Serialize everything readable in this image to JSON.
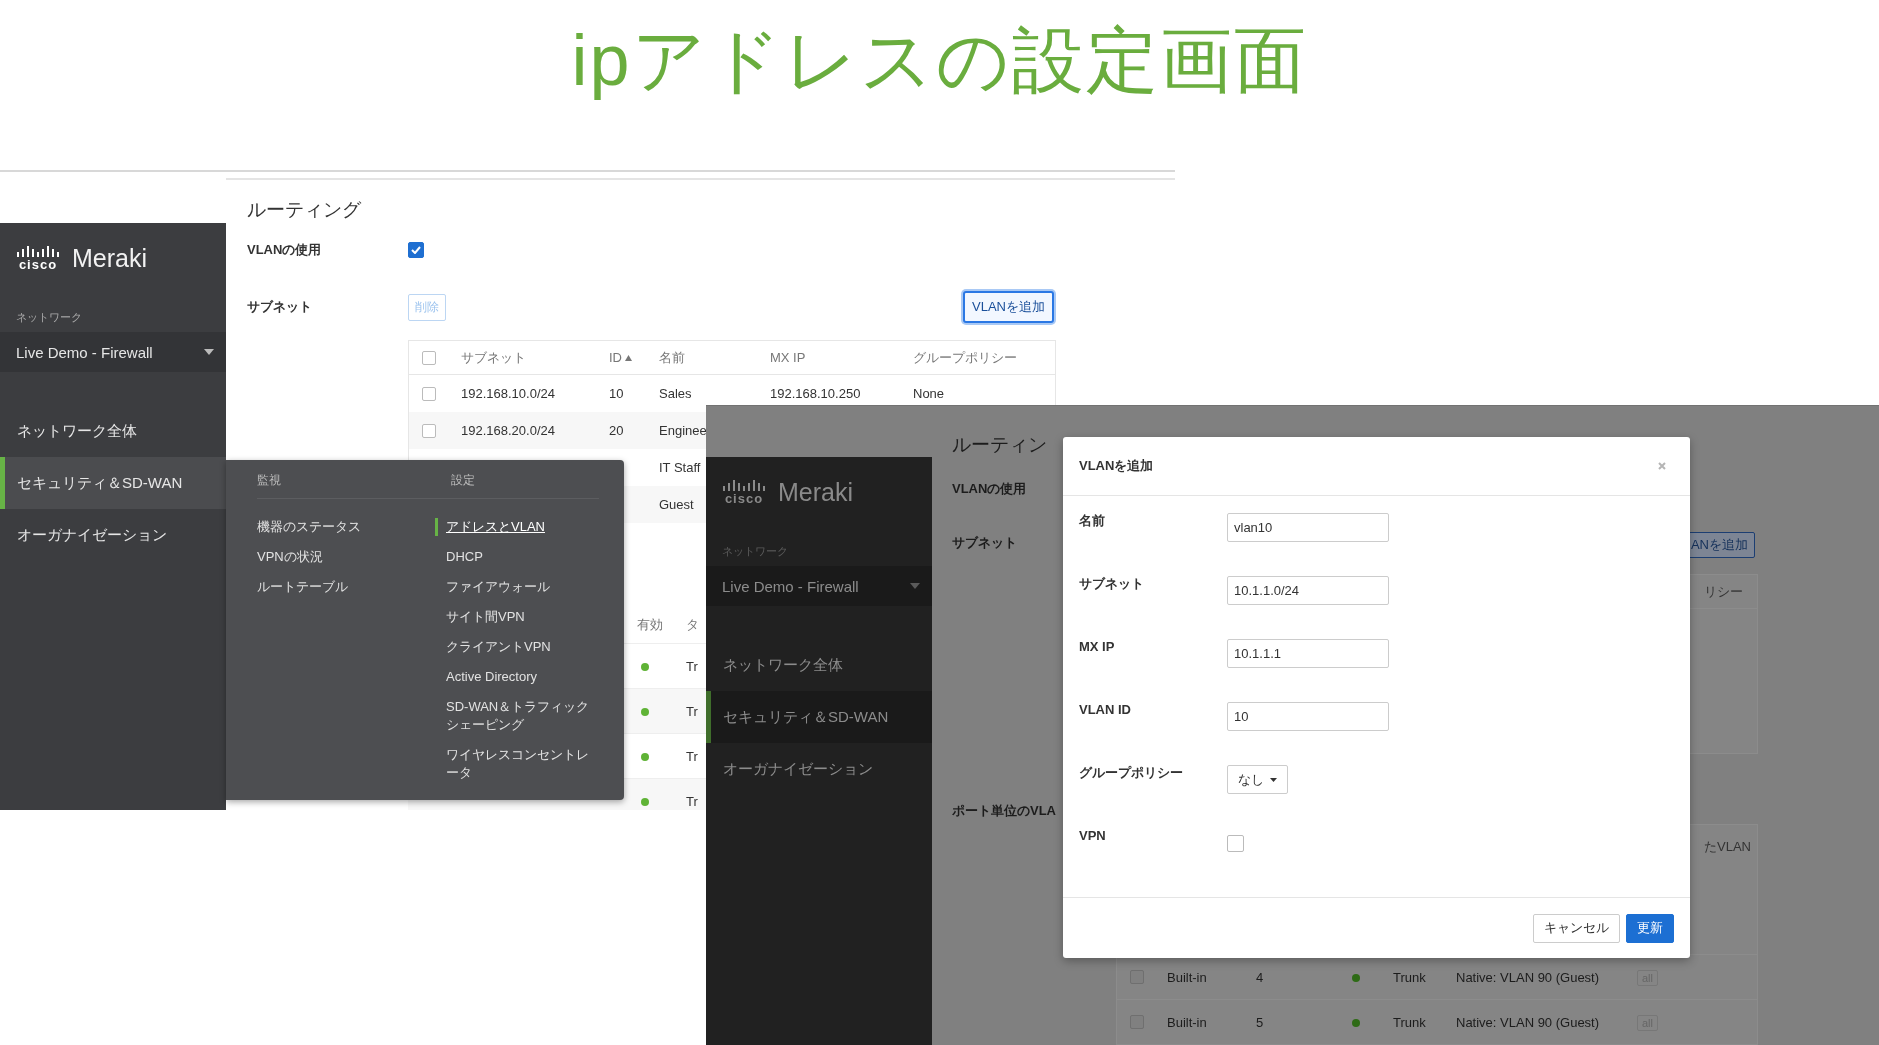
{
  "slide_title": "ipアドレスの設定画面",
  "screen_1": {
    "logo_text": "cisco",
    "brand": "Meraki",
    "sidebar": {
      "section_label": "ネットワーク",
      "network_selector": "Live Demo - Firewall",
      "items": [
        {
          "label": "ネットワーク全体",
          "selected": false
        },
        {
          "label": "セキュリティ＆SD-WAN",
          "selected": true
        },
        {
          "label": "オーガナイゼーション",
          "selected": false
        }
      ]
    },
    "page_title": "ルーティング",
    "vlan_toggle": {
      "label": "VLANの使用",
      "checked": true
    },
    "subnet_label": "サブネット",
    "delete_button": "削除",
    "add_vlan_button": "VLANを追加",
    "subnet_table": {
      "all_checked": false,
      "columns": [
        {
          "label": "サブネット",
          "sorted": false
        },
        {
          "label": "ID",
          "sorted": true
        },
        {
          "label": "名前",
          "sorted": false
        },
        {
          "label": "MX IP",
          "sorted": false
        },
        {
          "label": "グループポリシー",
          "sorted": false
        }
      ],
      "rows": [
        {
          "checked": false,
          "subnet": "192.168.10.0/24",
          "id": "10",
          "name": "Sales",
          "mx_ip": "192.168.10.250",
          "group_policy": "None"
        },
        {
          "checked": false,
          "subnet": "192.168.20.0/24",
          "id": "20",
          "name": "Enginee"
        },
        {
          "name": "IT Staff"
        },
        {
          "name": "Guest"
        }
      ]
    },
    "port_table": {
      "columns": [
        "有効",
        "タ"
      ],
      "rows": [
        {
          "enabled": true,
          "type": "Tr"
        },
        {
          "enabled": true,
          "type": "Tr"
        },
        {
          "enabled": true,
          "type": "Tr"
        },
        {
          "enabled": true,
          "type": "Tr"
        }
      ]
    },
    "menu": {
      "columns": [
        {
          "heading": "監視",
          "items": [
            {
              "label": "機器のステータス",
              "selected": false
            },
            {
              "label": "VPNの状況",
              "selected": false
            },
            {
              "label": "ルートテーブル",
              "selected": false
            }
          ]
        },
        {
          "heading": "設定",
          "items": [
            {
              "label": "アドレスとVLAN",
              "selected": true
            },
            {
              "label": "DHCP",
              "selected": false
            },
            {
              "label": "ファイアウォール",
              "selected": false
            },
            {
              "label": "サイト間VPN",
              "selected": false
            },
            {
              "label": "クライアントVPN",
              "selected": false
            },
            {
              "label": "Active Directory",
              "selected": false
            },
            {
              "label": "SD-WAN＆トラフィックシェーピング",
              "selected": false
            },
            {
              "label": "ワイヤレスコンセントレータ",
              "selected": false
            }
          ]
        }
      ]
    }
  },
  "screen_2": {
    "logo_text": "cisco",
    "brand": "Meraki",
    "sidebar": {
      "section_label": "ネットワーク",
      "network_selector": "Live Demo - Firewall",
      "items": [
        {
          "label": "ネットワーク全体",
          "selected": false
        },
        {
          "label": "セキュリティ＆SD-WAN",
          "selected": true
        },
        {
          "label": "オーガナイゼーション",
          "selected": false
        }
      ]
    },
    "page_title": "ルーティン",
    "vlan_label": "VLANの使用",
    "subnet_label": "サブネット",
    "port_label": "ポート単位のVLA",
    "add_vlan_button": "ANを追加",
    "column_fragment": "リシー",
    "column_fragment_2": "たVLAN",
    "port_rows": [
      {
        "checked": false,
        "type": "Built-in",
        "port": "4",
        "enabled": true,
        "mode": "Trunk",
        "vlan": "Native: VLAN 90 (Guest)",
        "allowed": "all"
      },
      {
        "checked": false,
        "type": "Built-in",
        "port": "5",
        "enabled": true,
        "mode": "Trunk",
        "vlan": "Native: VLAN 90 (Guest)",
        "allowed": "all"
      }
    ]
  },
  "dialog": {
    "title": "VLANを追加",
    "fields": [
      {
        "kind": "text",
        "label": "名前",
        "value": "vlan10"
      },
      {
        "kind": "text",
        "label": "サブネット",
        "value": "10.1.1.0/24"
      },
      {
        "kind": "text",
        "label": "MX IP",
        "value": "10.1.1.1"
      },
      {
        "kind": "text",
        "label": "VLAN ID",
        "value": "10"
      },
      {
        "kind": "select",
        "label": "グループポリシー",
        "value": "なし"
      },
      {
        "kind": "checkbox",
        "label": "VPN",
        "checked": false
      }
    ],
    "buttons": [
      {
        "label": "キャンセル",
        "primary": false
      },
      {
        "label": "更新",
        "primary": true
      }
    ]
  }
}
